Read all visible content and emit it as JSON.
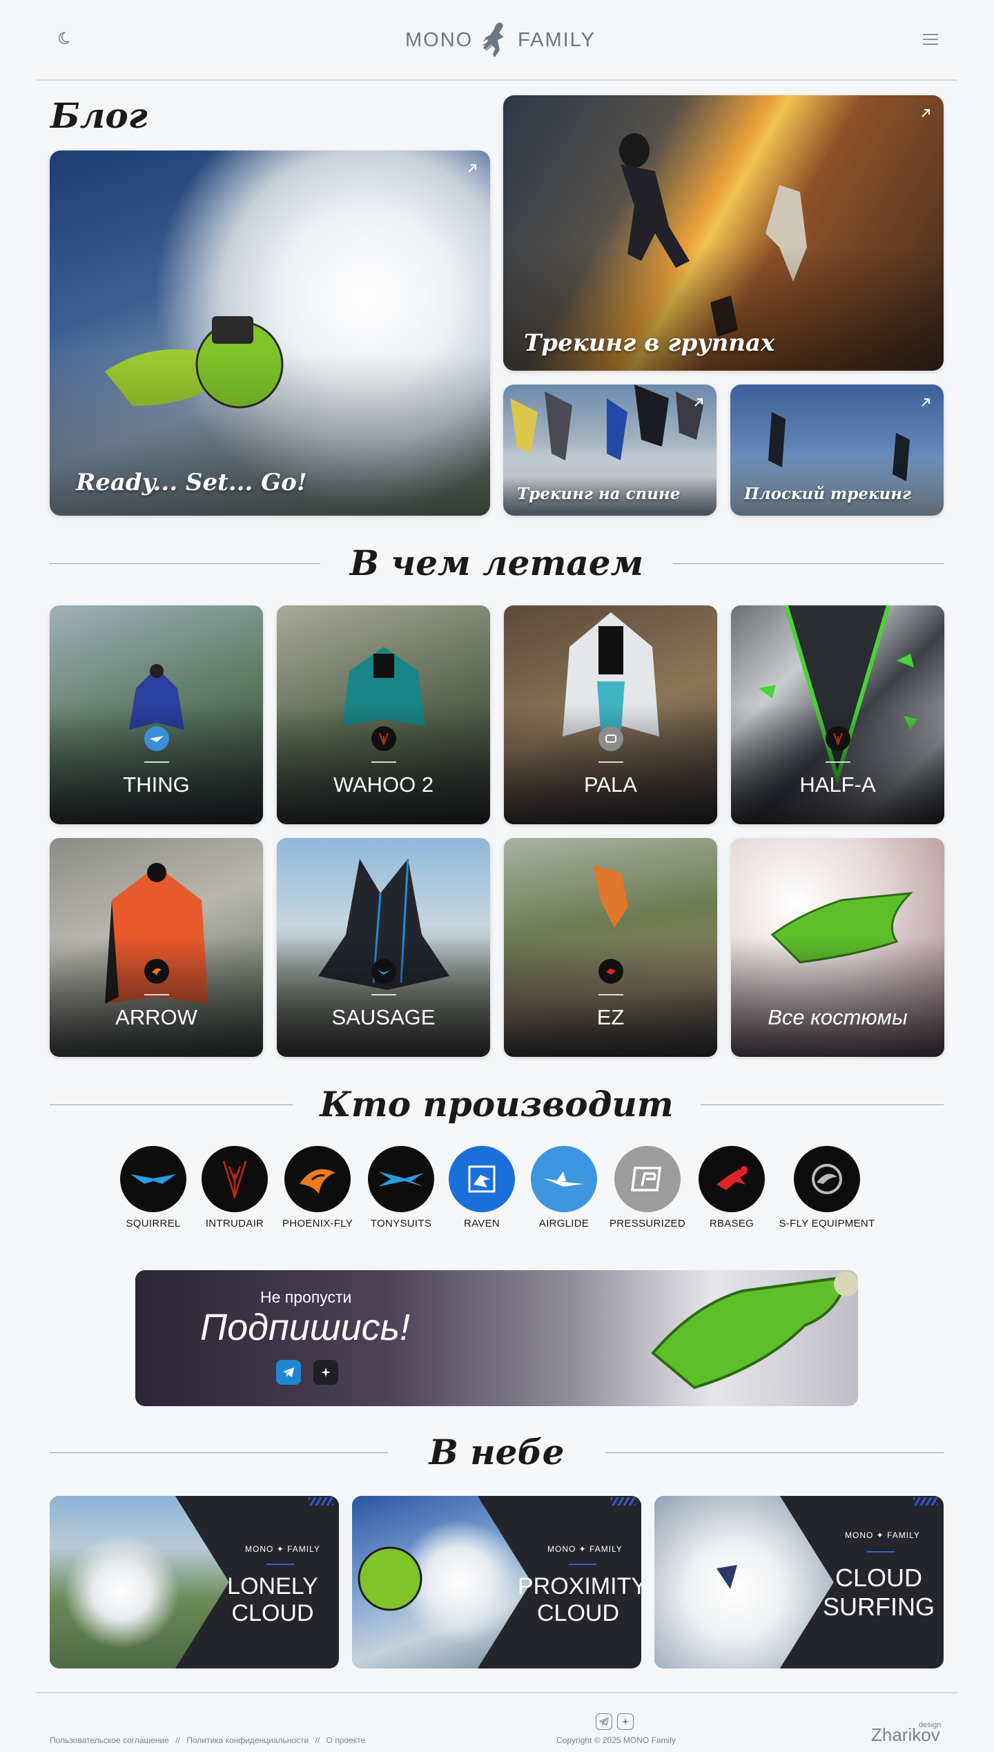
{
  "header": {
    "logo_left": "MONO",
    "logo_right": "FAMILY",
    "theme_icon": "moon-icon",
    "menu_icon": "hamburger-icon"
  },
  "blog": {
    "title": "Блог",
    "cards": [
      {
        "caption": "Ready... Set... Go!"
      },
      {
        "caption": "Трекинг в группах"
      },
      {
        "caption": "Трекинг на спине"
      },
      {
        "caption": "Плоский трекинг"
      }
    ]
  },
  "suits": {
    "title": "В чем летаем",
    "items": [
      {
        "name": "THING",
        "badge_color": "#3a8fd9"
      },
      {
        "name": "WAHOO 2",
        "badge_color": "#111111"
      },
      {
        "name": "PALA",
        "badge_color": "#8c8c8c"
      },
      {
        "name": "HALF-A",
        "badge_color": "#111111"
      },
      {
        "name": "ARROW",
        "badge_color": "#111111"
      },
      {
        "name": "SAUSAGE",
        "badge_color": "#111111"
      },
      {
        "name": "EZ",
        "badge_color": "#111111"
      },
      {
        "name": "Все костюмы"
      }
    ]
  },
  "makers": {
    "title": "Кто производит",
    "brands": [
      {
        "label": "SQUIRREL",
        "color": "#0d0d0d",
        "icon": "squirrel-logo-icon"
      },
      {
        "label": "INTRUDAIR",
        "color": "#0d0d0d",
        "icon": "intrudair-logo-icon"
      },
      {
        "label": "PHOENIX-FLY",
        "color": "#0d0d0d",
        "icon": "phoenix-fly-logo-icon"
      },
      {
        "label": "TONYSUITS",
        "color": "#0d0d0d",
        "icon": "tonysuits-logo-icon"
      },
      {
        "label": "RAVEN",
        "color": "#1a6fd9",
        "icon": "raven-logo-icon"
      },
      {
        "label": "AIRGLIDE",
        "color": "#3d95e0",
        "icon": "airglide-logo-icon"
      },
      {
        "label": "PRESSURIZED",
        "color": "#9c9c9c",
        "icon": "pressurized-logo-icon"
      },
      {
        "label": "RBASEG",
        "color": "#0d0d0d",
        "icon": "rbaseg-logo-icon"
      },
      {
        "label": "S-FLY EQUIPMENT",
        "color": "#0d0d0d",
        "icon": "s-fly-logo-icon"
      }
    ]
  },
  "subscribe": {
    "pretitle": "Не пропусти",
    "title": "Подпишись!"
  },
  "sky": {
    "title": "В небе",
    "cards": [
      {
        "brand_left": "MONO",
        "brand_right": "FAMILY",
        "line1": "LONELY",
        "line2": "CLOUD"
      },
      {
        "brand_left": "MONO",
        "brand_right": "FAMILY",
        "line1": "PROXIMITY",
        "line2": "CLOUD"
      },
      {
        "brand_left": "MONO",
        "brand_right": "FAMILY",
        "line1": "CLOUD",
        "line2": "SURFING"
      }
    ]
  },
  "footer": {
    "links": [
      "Пользовательское соглашение",
      "Политика конфиденциальности",
      "О проекте"
    ],
    "separator": "//",
    "copyright": "Copyright © 2025 MONO Family",
    "designer": "Zharikov",
    "designer_sup": "design"
  }
}
